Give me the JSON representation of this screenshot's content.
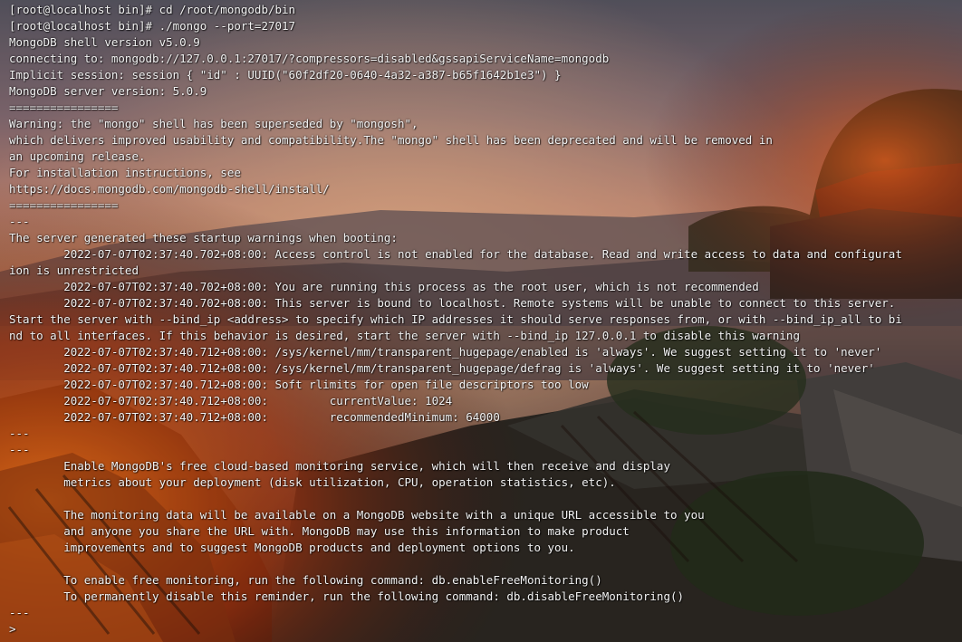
{
  "terminal": {
    "lines": [
      "[root@localhost bin]# cd /root/mongodb/bin",
      "[root@localhost bin]# ./mongo --port=27017",
      "MongoDB shell version v5.0.9",
      "connecting to: mongodb://127.0.0.1:27017/?compressors=disabled&gssapiServiceName=mongodb",
      "Implicit session: session { \"id\" : UUID(\"60f2df20-0640-4a32-a387-b65f1642b1e3\") }",
      "MongoDB server version: 5.0.9",
      "================",
      "Warning: the \"mongo\" shell has been superseded by \"mongosh\",",
      "which delivers improved usability and compatibility.The \"mongo\" shell has been deprecated and will be removed in",
      "an upcoming release.",
      "For installation instructions, see",
      "https://docs.mongodb.com/mongodb-shell/install/",
      "================",
      "---",
      "The server generated these startup warnings when booting:",
      "        2022-07-07T02:37:40.702+08:00: Access control is not enabled for the database. Read and write access to data and configurat",
      "ion is unrestricted",
      "        2022-07-07T02:37:40.702+08:00: You are running this process as the root user, which is not recommended",
      "        2022-07-07T02:37:40.702+08:00: This server is bound to localhost. Remote systems will be unable to connect to this server.",
      "Start the server with --bind_ip <address> to specify which IP addresses it should serve responses from, or with --bind_ip_all to bi",
      "nd to all interfaces. If this behavior is desired, start the server with --bind_ip 127.0.0.1 to disable this warning",
      "        2022-07-07T02:37:40.712+08:00: /sys/kernel/mm/transparent_hugepage/enabled is 'always'. We suggest setting it to 'never'",
      "        2022-07-07T02:37:40.712+08:00: /sys/kernel/mm/transparent_hugepage/defrag is 'always'. We suggest setting it to 'never'",
      "        2022-07-07T02:37:40.712+08:00: Soft rlimits for open file descriptors too low",
      "        2022-07-07T02:37:40.712+08:00:         currentValue: 1024",
      "        2022-07-07T02:37:40.712+08:00:         recommendedMinimum: 64000",
      "---",
      "---",
      "        Enable MongoDB's free cloud-based monitoring service, which will then receive and display",
      "        metrics about your deployment (disk utilization, CPU, operation statistics, etc).",
      "",
      "        The monitoring data will be available on a MongoDB website with a unique URL accessible to you",
      "        and anyone you share the URL with. MongoDB may use this information to make product",
      "        improvements and to suggest MongoDB products and deployment options to you.",
      "",
      "        To enable free monitoring, run the following command: db.enableFreeMonitoring()",
      "        To permanently disable this reminder, run the following command: db.disableFreeMonitoring()",
      "---",
      ">"
    ]
  },
  "theme": {
    "text_color": "#f2f2f2",
    "sky_top": "#6e6a78",
    "sky_glow": "#e8a27a",
    "roof_dark": "#2e2722"
  }
}
